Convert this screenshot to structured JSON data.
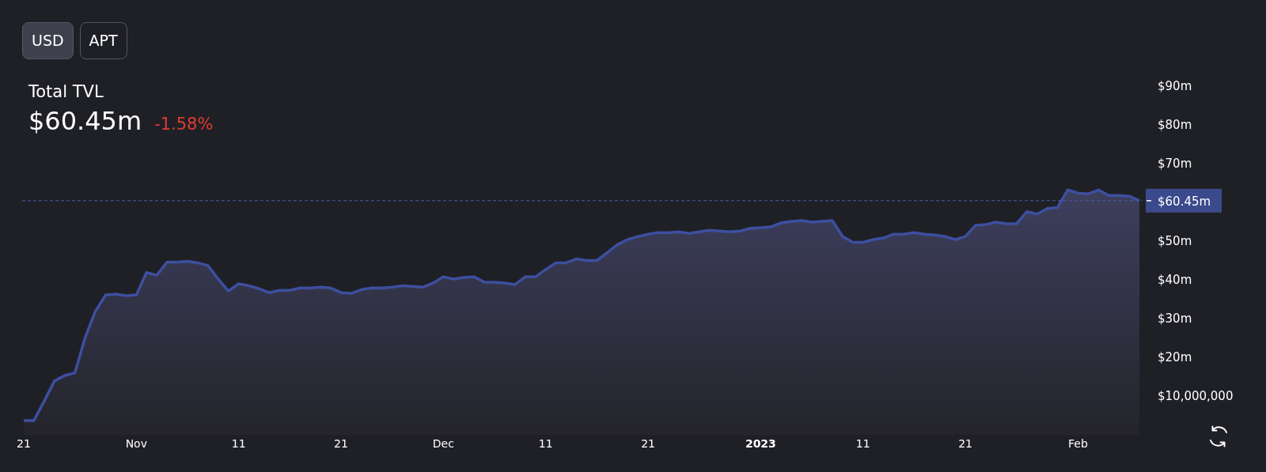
{
  "currency_toggle": [
    {
      "label": "USD",
      "selected": true
    },
    {
      "label": "APT",
      "selected": false
    }
  ],
  "summary": {
    "title": "Total TVL",
    "value": "$60.45m",
    "change": "-1.58%"
  },
  "chart": {
    "current_value_label": "$60.45m",
    "chart_data": {
      "type": "area",
      "xlim": [
        "2022-10-21",
        "2023-02-07"
      ],
      "ylim": [
        0,
        90000000
      ],
      "x": [
        "2022-10-21",
        "2022-10-22",
        "2022-10-23",
        "2022-10-24",
        "2022-10-25",
        "2022-10-26",
        "2022-10-27",
        "2022-10-28",
        "2022-10-29",
        "2022-10-30",
        "2022-10-31",
        "2022-11-01",
        "2022-11-02",
        "2022-11-03",
        "2022-11-04",
        "2022-11-05",
        "2022-11-06",
        "2022-11-07",
        "2022-11-08",
        "2022-11-09",
        "2022-11-10",
        "2022-11-11",
        "2022-11-12",
        "2022-11-13",
        "2022-11-14",
        "2022-11-15",
        "2022-11-16",
        "2022-11-17",
        "2022-11-18",
        "2022-11-19",
        "2022-11-20",
        "2022-11-21",
        "2022-11-22",
        "2022-11-23",
        "2022-11-24",
        "2022-11-25",
        "2022-11-26",
        "2022-11-27",
        "2022-11-28",
        "2022-11-29",
        "2022-11-30",
        "2022-12-01",
        "2022-12-02",
        "2022-12-03",
        "2022-12-04",
        "2022-12-05",
        "2022-12-06",
        "2022-12-07",
        "2022-12-08",
        "2022-12-09",
        "2022-12-10",
        "2022-12-11",
        "2022-12-12",
        "2022-12-13",
        "2022-12-14",
        "2022-12-15",
        "2022-12-16",
        "2022-12-17",
        "2022-12-18",
        "2022-12-19",
        "2022-12-20",
        "2022-12-21",
        "2022-12-22",
        "2022-12-23",
        "2022-12-24",
        "2022-12-25",
        "2022-12-26",
        "2022-12-27",
        "2022-12-28",
        "2022-12-29",
        "2022-12-30",
        "2022-12-31",
        "2023-01-01",
        "2023-01-02",
        "2023-01-03",
        "2023-01-04",
        "2023-01-05",
        "2023-01-06",
        "2023-01-07",
        "2023-01-08",
        "2023-01-09",
        "2023-01-10",
        "2023-01-11",
        "2023-01-12",
        "2023-01-13",
        "2023-01-14",
        "2023-01-15",
        "2023-01-16",
        "2023-01-17",
        "2023-01-18",
        "2023-01-19",
        "2023-01-20",
        "2023-01-21",
        "2023-01-22",
        "2023-01-23",
        "2023-01-24",
        "2023-01-25",
        "2023-01-26",
        "2023-01-27",
        "2023-01-28",
        "2023-01-29",
        "2023-01-30",
        "2023-01-31",
        "2023-02-01",
        "2023-02-02",
        "2023-02-03",
        "2023-02-04",
        "2023-02-05",
        "2023-02-06",
        "2023-02-07"
      ],
      "xticks": [
        {
          "value": "2022-10-21",
          "label": "21"
        },
        {
          "value": "2022-11-01",
          "label": "Nov"
        },
        {
          "value": "2022-11-11",
          "label": "11"
        },
        {
          "value": "2022-11-21",
          "label": "21"
        },
        {
          "value": "2022-12-01",
          "label": "Dec"
        },
        {
          "value": "2022-12-11",
          "label": "11"
        },
        {
          "value": "2022-12-21",
          "label": "21"
        },
        {
          "value": "2023-01-01",
          "label": "2023"
        },
        {
          "value": "2023-01-11",
          "label": "11"
        },
        {
          "value": "2023-01-21",
          "label": "21"
        },
        {
          "value": "2023-02-01",
          "label": "Feb"
        }
      ],
      "yticks": [
        {
          "value": 10000000,
          "label": "$10,000,000"
        },
        {
          "value": 20000000,
          "label": "$20m"
        },
        {
          "value": 30000000,
          "label": "$30m"
        },
        {
          "value": 40000000,
          "label": "$40m"
        },
        {
          "value": 50000000,
          "label": "$50m"
        },
        {
          "value": 70000000,
          "label": "$70m"
        },
        {
          "value": 80000000,
          "label": "$80m"
        },
        {
          "value": 90000000,
          "label": "$90m"
        }
      ],
      "ref_lines": [
        {
          "axis": "y",
          "value": 60450000
        }
      ],
      "series": [
        {
          "color": "#3d4f9f",
          "values": [
            3700000,
            3700000,
            8700000,
            13900000,
            15300000,
            16000000,
            25100000,
            31900000,
            36100000,
            36300000,
            35900000,
            36100000,
            41900000,
            41200000,
            44600000,
            44600000,
            44800000,
            44400000,
            43700000,
            40200000,
            37100000,
            39000000,
            38500000,
            37700000,
            36700000,
            37300000,
            37300000,
            37900000,
            37900000,
            38100000,
            37900000,
            36700000,
            36500000,
            37500000,
            37900000,
            37900000,
            38100000,
            38500000,
            38300000,
            38100000,
            39200000,
            40800000,
            40200000,
            40600000,
            40800000,
            39400000,
            39400000,
            39200000,
            38800000,
            40800000,
            40800000,
            42700000,
            44400000,
            44400000,
            45400000,
            45000000,
            45000000,
            47000000,
            49100000,
            50400000,
            51200000,
            51800000,
            52200000,
            52200000,
            52400000,
            52000000,
            52400000,
            52800000,
            52600000,
            52400000,
            52600000,
            53300000,
            53500000,
            53700000,
            54700000,
            55100000,
            55300000,
            54900000,
            55100000,
            55300000,
            51200000,
            49700000,
            49700000,
            50400000,
            50800000,
            51800000,
            51800000,
            52200000,
            51800000,
            51600000,
            51200000,
            50400000,
            51200000,
            54100000,
            54300000,
            54900000,
            54500000,
            54500000,
            57600000,
            57000000,
            58400000,
            58700000,
            63200000,
            62400000,
            62200000,
            63200000,
            61800000,
            61800000,
            61600000,
            60450000
          ]
        }
      ]
    }
  }
}
